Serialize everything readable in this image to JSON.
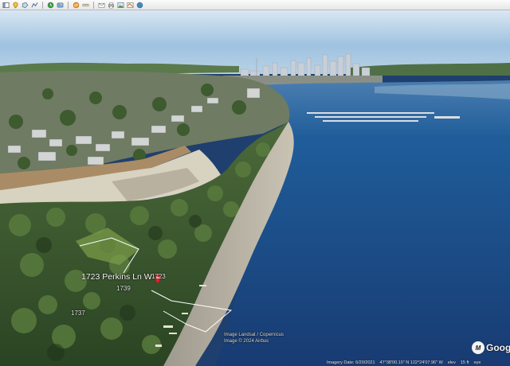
{
  "toolbar": {
    "groups": [
      [
        "sidebar-icon",
        "add-placemark-icon",
        "add-polygon-icon",
        "add-path-icon"
      ],
      [
        "historical-imagery-icon",
        "sunlight-icon"
      ],
      [
        "switch-to-sky-icon",
        "ruler-icon"
      ],
      [
        "email-icon",
        "print-icon",
        "save-image-icon",
        "view-in-maps-icon",
        "earth-globe-icon"
      ]
    ]
  },
  "map": {
    "parcel_label": "1723 Perkins Ln W",
    "parcel_suffix": "1723",
    "lot_1739": "1739",
    "lot_1737": "1737",
    "pin_color": "#e0232e",
    "parcel_outline_color": "#ffffff",
    "water_color": "#1f4b86"
  },
  "attribution": {
    "line1": "Image Landsat / Copernicus",
    "line2": "Image © 2024 Airbus"
  },
  "status": {
    "imagery_date": "Imagery Date: 6/20/2021",
    "coordinates": "47°38'00.10\" N  122°24'07.96\" W",
    "elev": "elev",
    "elev_value": "15 ft",
    "eye": "eye"
  },
  "logo": {
    "badge": "M",
    "word": "Goog"
  }
}
